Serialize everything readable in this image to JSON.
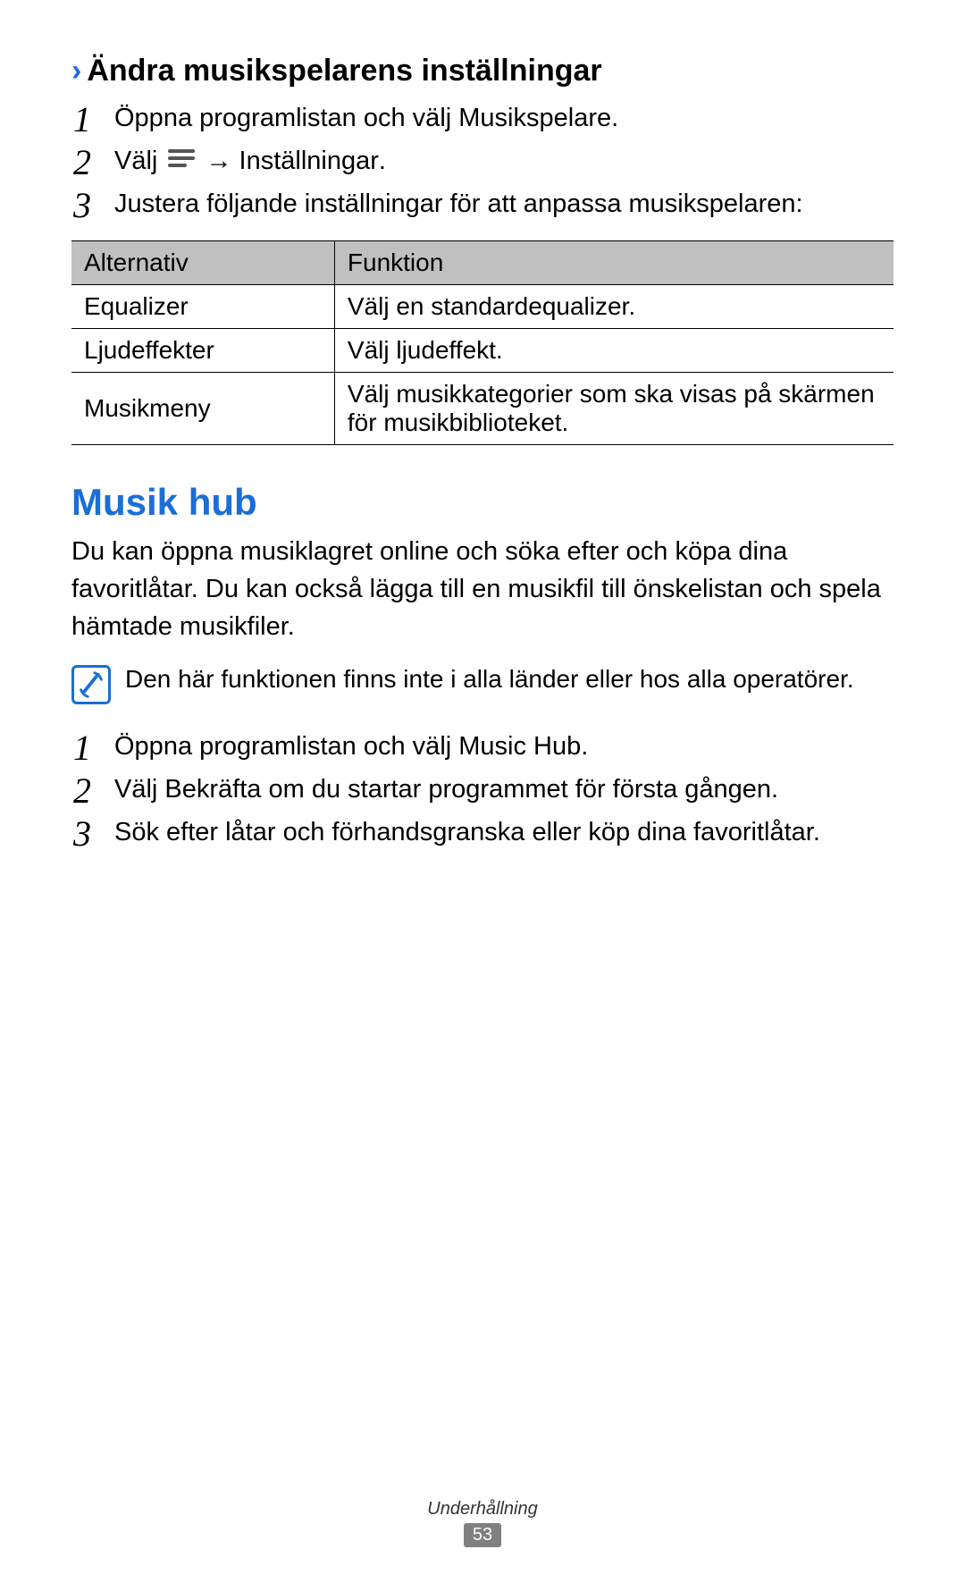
{
  "sections": {
    "subheading": "Ändra musikspelarens inställningar",
    "steps1": {
      "s1_a": "Öppna programlistan och välj ",
      "s1_b": "Musikspelare",
      "s1_c": ".",
      "s2_a": "Välj ",
      "s2_b": " → ",
      "s2_c": "Inställningar",
      "s2_d": ".",
      "s3": "Justera följande inställningar för att anpassa musikspelaren:"
    },
    "table": {
      "h1": "Alternativ",
      "h2": "Funktion",
      "rows": [
        {
          "a": "Equalizer",
          "b": "Välj en standardequalizer."
        },
        {
          "a": "Ljudeffekter",
          "b": "Välj ljudeffekt."
        },
        {
          "a": "Musikmeny",
          "b": "Välj musikkategorier som ska visas på skärmen för musikbiblioteket."
        }
      ]
    },
    "title2": "Musik hub",
    "body2": "Du kan öppna musiklagret online och söka efter och köpa dina favoritlåtar. Du kan också lägga till en musikfil till önskelistan och spela hämtade musikfiler.",
    "note": "Den här funktionen finns inte i alla länder eller hos alla operatörer.",
    "steps2": {
      "s1_a": "Öppna programlistan och välj ",
      "s1_b": "Music Hub",
      "s1_c": ".",
      "s2_a": "Välj ",
      "s2_b": "Bekräfta",
      "s2_c": " om du startar programmet för första gången.",
      "s3": "Sök efter låtar och förhandsgranska eller köp dina favoritlåtar."
    }
  },
  "footer": {
    "label": "Underhållning",
    "page": "53"
  }
}
